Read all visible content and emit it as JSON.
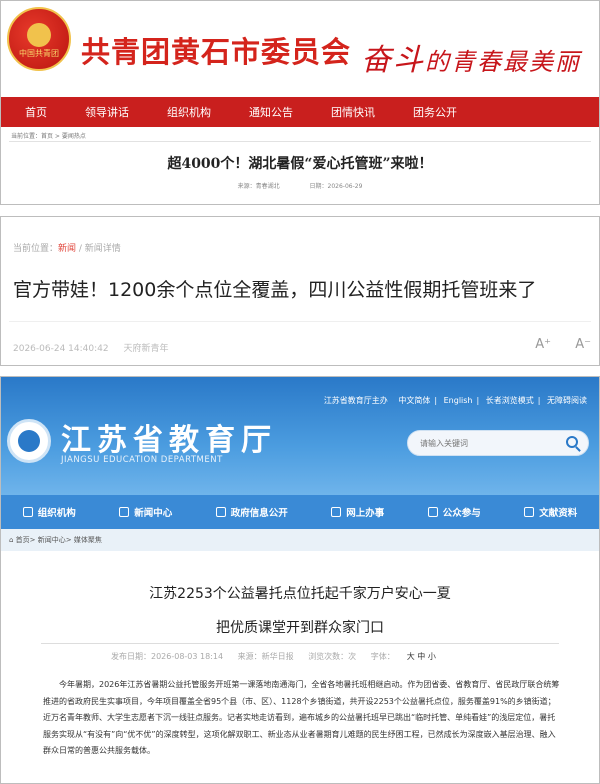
{
  "panel1": {
    "emblem_text": "中国共青团",
    "org_name": "共青团黄石市委员会",
    "slogan_part1": "奋斗",
    "slogan_part2": "的青春最美丽",
    "nav": [
      "首页",
      "领导讲话",
      "组织机构",
      "通知公告",
      "团情快讯",
      "团务公开"
    ],
    "breadcrumb": "当前位置：首页 > 要闻热点",
    "title": "超4000个！湖北暑假“爱心托管班”来啦！",
    "source": "来源：青春湖北",
    "date": "日期：2026-06-29"
  },
  "panel2": {
    "crumb_prefix": "当前位置：",
    "crumb_news": "新闻",
    "crumb_rest": " / 新闻详情",
    "title": "官方带娃！1200余个点位全覆盖，四川公益性假期托管班来了",
    "time": "2026-06-24 14:40:42",
    "source": "天府新青年",
    "font_larger": "A⁺",
    "font_smaller": "A⁻"
  },
  "panel3": {
    "top_links": [
      "江苏省教育厅主办",
      "中文简体",
      "English",
      "长者浏览模式",
      "无障碍阅读"
    ],
    "site_cn": "江苏省教育厅",
    "site_en": "JIANGSU EDUCATION DEPARTMENT",
    "search_placeholder": "请输入关键词",
    "nav": [
      "组织机构",
      "新闻中心",
      "政府信息公开",
      "网上办事",
      "公众参与",
      "文献资料"
    ],
    "breadcrumb": "首页> 新闻中心> 媒体聚焦",
    "title_line1": "江苏2253个公益暑托点位托起千家万户安心一夏",
    "title_line2": "把优质课堂开到群众家门口",
    "publish": "发布日期：2026-08-03 18:14",
    "source": "来源：新华日报",
    "views": "浏览次数：次",
    "fontsize_label": "字体：",
    "fontsize_opts": "大 中 小",
    "body": "今年暑期，2026年江苏省暑期公益托管服务开班第一课落地南通海门，全省各地暑托班相继启动。作为团省委、省教育厅、省民政厅联合统筹推进的省政府民生实事项目，今年项目覆盖全省95个县（市、区）、1128个乡镇街道，共开设2253个公益暑托点位，服务覆盖91%的乡镇街道；近万名青年教师、大学生志愿者下沉一线驻点服务。记者实地走访看到，遍布城乡的公益暑托班早已跳出“临时托管、单纯看娃”的浅层定位，暑托服务实现从“有没有”向“优不优”的深度转型，这项化解双职工、新业态从业者暑期育儿难题的民生纾困工程，已然成长为深度嵌入基层治理、融入群众日常的普惠公共服务载体。"
  }
}
